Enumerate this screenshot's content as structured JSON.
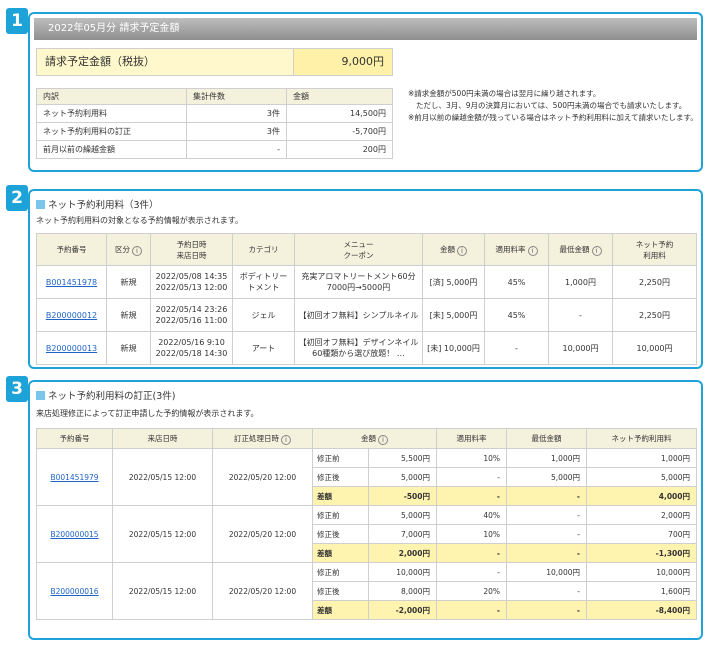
{
  "badges": [
    "1",
    "2",
    "3"
  ],
  "section1": {
    "header": "2022年05月分 請求予定金額",
    "summary_label": "請求予定金額（税抜）",
    "summary_value": "9,000円",
    "columns": [
      "内訳",
      "集計件数",
      "金額"
    ],
    "rows": [
      {
        "label": "ネット予約利用料",
        "count": "3件",
        "amount": "14,500円"
      },
      {
        "label": "ネット予約利用料の訂正",
        "count": "3件",
        "amount": "-5,700円"
      },
      {
        "label": "前月以前の繰越金額",
        "count": "-",
        "amount": "200円"
      }
    ],
    "notes": [
      "※請求金額が500円未満の場合は翌月に繰り越されます。",
      "ただし、3月、9月の決算月においては、500円未満の場合でも請求いたします。",
      "※前月以前の繰越金額が残っている場合はネット予約利用料に加えて請求いたします。"
    ]
  },
  "section2": {
    "title": "ネット予約利用料（3件）",
    "description": "ネット予約利用料の対象となる予約情報が表示されます。",
    "columns": [
      "予約番号",
      "区分",
      "予約日時",
      "来店日時",
      "カテゴリ",
      "メニュー",
      "クーポン",
      "金額",
      "適用料率",
      "最低金額",
      "ネット予約",
      "利用料"
    ],
    "info_icon": "info-icon",
    "rows": [
      {
        "id": "B001451978",
        "type": "新規",
        "reserved": "2022/05/08 14:35",
        "visit": "2022/05/13 12:00",
        "category": "ボディトリートメント",
        "menu": "充実アロマトリートメント60分 7000円→5000円",
        "price": "[済] 5,000円",
        "rate": "45%",
        "min": "1,000円",
        "fee": "2,250円"
      },
      {
        "id": "B200000012",
        "type": "新規",
        "reserved": "2022/05/14 23:26",
        "visit": "2022/05/16 11:00",
        "category": "ジェル",
        "menu": "【初回オフ無料】シンプルネイル",
        "price": "[未] 5,000円",
        "rate": "45%",
        "min": "-",
        "fee": "2,250円"
      },
      {
        "id": "B200000013",
        "type": "新規",
        "reserved": "2022/05/16 9:10",
        "visit": "2022/05/18 14:30",
        "category": "アート",
        "menu": "【初回オフ無料】デザインネイル60種類から選び放題！ …",
        "price": "[未] 10,000円",
        "rate": "-",
        "min": "10,000円",
        "fee": "10,000円"
      }
    ]
  },
  "section3": {
    "title": "ネット予約利用料の訂正(3件)",
    "description": "来店処理修正によって訂正申請した予約情報が表示されます。",
    "columns": [
      "予約番号",
      "来店日時",
      "訂正処理日時",
      "金額",
      "適用料率",
      "最低金額",
      "ネット予約利用料"
    ],
    "row_labels": [
      "修正前",
      "修正後",
      "差額"
    ],
    "groups": [
      {
        "id": "B001451979",
        "visit": "2022/05/15 12:00",
        "fixed": "2022/05/20 12:00",
        "before": {
          "amount": "5,500円",
          "rate": "10%",
          "min": "1,000円",
          "fee": "1,000円"
        },
        "after": {
          "amount": "5,000円",
          "rate": "-",
          "min": "5,000円",
          "fee": "5,000円"
        },
        "diff": {
          "amount": "-500円",
          "rate": "-",
          "min": "-",
          "fee": "4,000円"
        }
      },
      {
        "id": "B200000015",
        "visit": "2022/05/15 12:00",
        "fixed": "2022/05/20 12:00",
        "before": {
          "amount": "5,000円",
          "rate": "40%",
          "min": "-",
          "fee": "2,000円"
        },
        "after": {
          "amount": "7,000円",
          "rate": "10%",
          "min": "-",
          "fee": "700円"
        },
        "diff": {
          "amount": "2,000円",
          "rate": "-",
          "min": "-",
          "fee": "-1,300円"
        }
      },
      {
        "id": "B200000016",
        "visit": "2022/05/15 12:00",
        "fixed": "2022/05/20 12:00",
        "before": {
          "amount": "10,000円",
          "rate": "-",
          "min": "10,000円",
          "fee": "10,000円"
        },
        "after": {
          "amount": "8,000円",
          "rate": "20%",
          "min": "-",
          "fee": "1,600円"
        },
        "diff": {
          "amount": "-2,000円",
          "rate": "-",
          "min": "-",
          "fee": "-8,400円"
        }
      }
    ]
  }
}
